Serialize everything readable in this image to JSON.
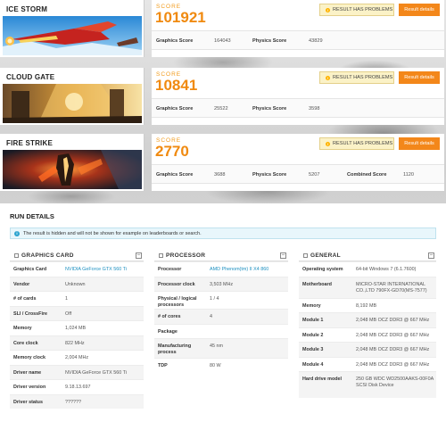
{
  "benchmarks": [
    {
      "name": "ICE STORM",
      "score_label": "SCORE",
      "score": "101921",
      "problem_label": "RESULT HAS PROBLEMS",
      "details_label": "Result details",
      "subscores": [
        {
          "label": "Graphics Score",
          "value": "164043"
        },
        {
          "label": "Physics Score",
          "value": "43829"
        }
      ]
    },
    {
      "name": "CLOUD GATE",
      "score_label": "SCORE",
      "score": "10841",
      "problem_label": "RESULT HAS PROBLEMS",
      "details_label": "Result details",
      "subscores": [
        {
          "label": "Graphics Score",
          "value": "25522"
        },
        {
          "label": "Physics Score",
          "value": "3598"
        }
      ]
    },
    {
      "name": "FIRE STRIKE",
      "score_label": "SCORE",
      "score": "2770",
      "problem_label": "RESULT HAS PROBLEMS",
      "details_label": "Result details",
      "subscores": [
        {
          "label": "Graphics Score",
          "value": "3688"
        },
        {
          "label": "Physics Score",
          "value": "5207"
        },
        {
          "label": "Combined Score",
          "value": "1120"
        }
      ]
    }
  ],
  "run_details": {
    "title": "RUN DETAILS",
    "notice": "The result is hidden and will not be shown for example on leaderboards or search.",
    "graphics": {
      "title": "GRAPHICS CARD",
      "rows": [
        {
          "k": "Graphics Card",
          "v": "NVIDIA GeForce GTX 560 Ti"
        },
        {
          "k": "Vendor",
          "v": "Unknown"
        },
        {
          "k": "# of cards",
          "v": "1"
        },
        {
          "k": "SLI / CrossFire",
          "v": "Off"
        },
        {
          "k": "Memory",
          "v": "1,024 MB"
        },
        {
          "k": "Core clock",
          "v": "822 MHz"
        },
        {
          "k": "Memory clock",
          "v": "2,004 MHz"
        },
        {
          "k": "Driver name",
          "v": "NVIDIA GeForce GTX 560 Ti"
        },
        {
          "k": "Driver version",
          "v": "9.18.13.697"
        },
        {
          "k": "Driver status",
          "v": "??????"
        }
      ]
    },
    "processor": {
      "title": "PROCESSOR",
      "rows": [
        {
          "k": "Processor",
          "v": "AMD Phenom(tm) II X4 860"
        },
        {
          "k": "Processor clock",
          "v": "3,503 MHz"
        },
        {
          "k": "Physical / logical processors",
          "v": "1 / 4"
        },
        {
          "k": "# of cores",
          "v": "4"
        },
        {
          "k": "Package",
          "v": ""
        },
        {
          "k": "Manufacturing process",
          "v": "45 nm"
        },
        {
          "k": "TDP",
          "v": "80 W"
        }
      ]
    },
    "general": {
      "title": "GENERAL",
      "rows": [
        {
          "k": "Operating system",
          "v": "64-bit Windows 7 (6.1.7600)"
        },
        {
          "k": "Motherboard",
          "v": "MICRO-STAR INTERNATIONAL CO.,LTD 790FX-GD70(MS-7577)"
        },
        {
          "k": "Memory",
          "v": "8,192 MB"
        },
        {
          "k": "Module 1",
          "v": "2,048 MB OCZ DDR3 @ 667 MHz"
        },
        {
          "k": "Module 2",
          "v": "2,048 MB OCZ DDR3 @ 667 MHz"
        },
        {
          "k": "Module 3",
          "v": "2,048 MB OCZ DDR3 @ 667 MHz"
        },
        {
          "k": "Module 4",
          "v": "2,048 MB OCZ DDR3 @ 667 MHz"
        },
        {
          "k": "Hard drive model",
          "v": "250 GB WDC WD2500AAKS-00F0A SCSI Disk Device"
        }
      ]
    }
  }
}
